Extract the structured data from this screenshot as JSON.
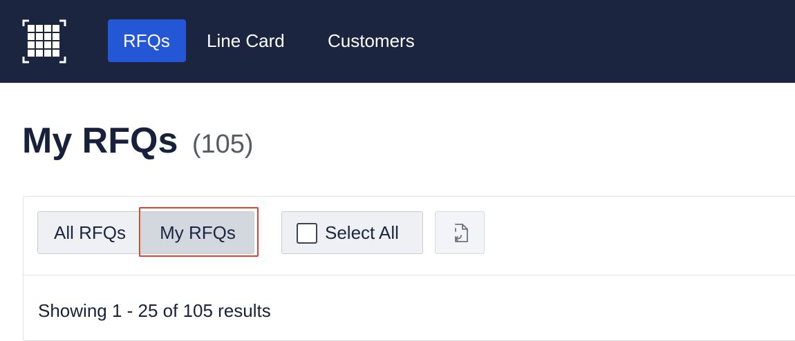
{
  "nav": {
    "logo_icon": "grid-logo-icon",
    "items": [
      {
        "label": "RFQs",
        "active": true
      },
      {
        "label": "Line Card",
        "active": false
      },
      {
        "label": "Customers",
        "active": false
      }
    ]
  },
  "page": {
    "title": "My RFQs",
    "count": "(105)"
  },
  "toolbar": {
    "filters": [
      {
        "label": "All RFQs",
        "selected": false
      },
      {
        "label": "My RFQs",
        "selected": true
      }
    ],
    "select_all_label": "Select All",
    "select_all_checked": false,
    "export_icon": "file-export-icon"
  },
  "results_text": "Showing 1 - 25 of 105 results",
  "colors": {
    "nav_bg": "#1b2540",
    "accent": "#2357d6",
    "highlight": "#d9432b"
  }
}
